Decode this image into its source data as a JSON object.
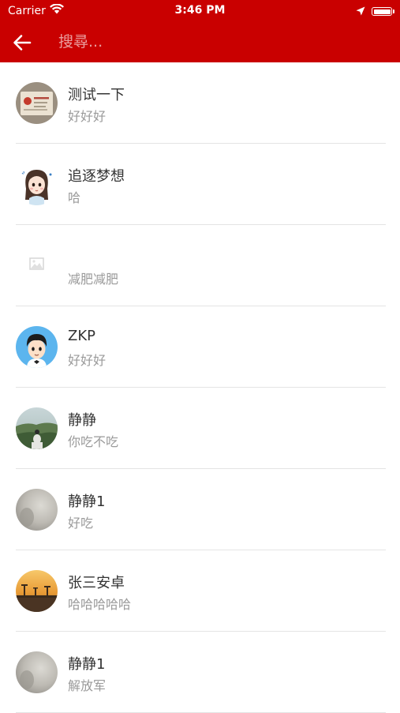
{
  "status_bar": {
    "carrier": "Carrier",
    "time": "3:46 PM"
  },
  "header": {
    "search_placeholder": "搜尋...",
    "background_color": "#c90000"
  },
  "contacts": [
    {
      "name": "测试一下",
      "message": "好好好",
      "avatar": "document-photo"
    },
    {
      "name": "追逐梦想",
      "message": "哈",
      "avatar": "cartoon-girl"
    },
    {
      "name": "",
      "message": "减肥减肥",
      "avatar": "image-placeholder-icon"
    },
    {
      "name": "ZKP",
      "message": "好好好",
      "avatar": "cartoon-boy"
    },
    {
      "name": "静静",
      "message": "你吃不吃",
      "avatar": "landscape-photo"
    },
    {
      "name": "静静1",
      "message": "好吃",
      "avatar": "blurry-photo"
    },
    {
      "name": "张三安卓",
      "message": "哈哈哈哈哈",
      "avatar": "sunset-photo"
    },
    {
      "name": "静静1",
      "message": "解放军",
      "avatar": "blurry-photo"
    }
  ]
}
